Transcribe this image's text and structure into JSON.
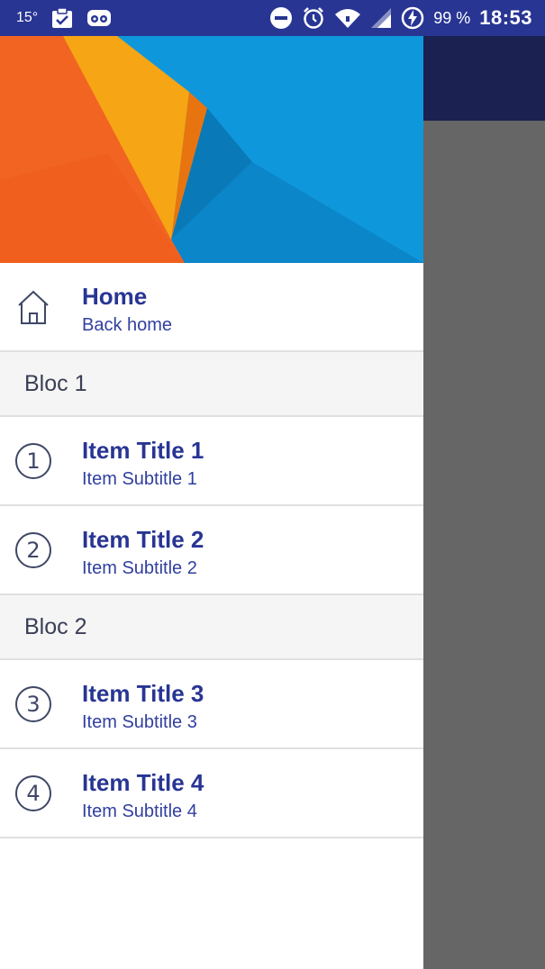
{
  "status_bar": {
    "temperature": "15°",
    "battery": "99 %",
    "time": "18:53",
    "icons": [
      "clipboard-check-icon",
      "voicemail-owl-icon",
      "do-not-disturb-icon",
      "alarm-icon",
      "wifi-icon",
      "signal-icon",
      "battery-charging-icon"
    ]
  },
  "drawer": {
    "home": {
      "title": "Home",
      "subtitle": "Back home",
      "icon": "home-icon"
    },
    "sections": [
      {
        "label": "Bloc 1",
        "items": [
          {
            "number": "1",
            "title": "Item Title 1",
            "subtitle": "Item Subtitle 1"
          },
          {
            "number": "2",
            "title": "Item Title 2",
            "subtitle": "Item Subtitle 2"
          }
        ]
      },
      {
        "label": "Bloc 2",
        "items": [
          {
            "number": "3",
            "title": "Item Title 3",
            "subtitle": "Item Subtitle 3"
          },
          {
            "number": "4",
            "title": "Item Title 4",
            "subtitle": "Item Subtitle 4"
          }
        ]
      }
    ]
  },
  "colors": {
    "status_bar": "#283593",
    "app_bar": "#1b2150",
    "scrim": "#666666",
    "title_text": "#283593",
    "section_bg": "#f5f5f5"
  }
}
